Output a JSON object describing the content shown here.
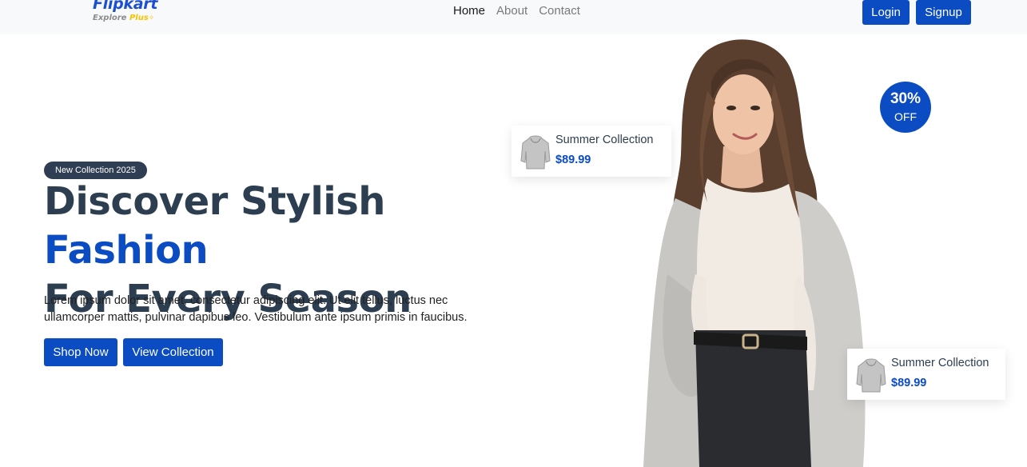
{
  "brand": {
    "name": "Flipkart",
    "sub": "Explore",
    "sub_plus": "Plus"
  },
  "nav": {
    "links": [
      "Home",
      "About",
      "Contact"
    ]
  },
  "auth": {
    "login": "Login",
    "signup": "Signup"
  },
  "hero": {
    "badge": "New Collection 2025",
    "title_part1": "Discover Stylish ",
    "title_accent": "Fashion",
    "title_part2": "For Every Season",
    "description": "Lorem ipsum dolor sit amet, consectetur adipiscing elit. Ut elit tellus, luctus nec ullamcorper mattis, pulvinar dapibus leo. Vestibulum ante ipsum primis in faucibus.",
    "shop_now": "Shop Now",
    "view_collection": "View Collection"
  },
  "cards": [
    {
      "title": "Summer Collection",
      "price": "$89.99",
      "thumb_icon": "hoodie-icon"
    },
    {
      "title": "Summer Collection",
      "price": "$89.99",
      "thumb_icon": "hoodie-icon"
    }
  ],
  "discount": {
    "percent": "30%",
    "label": "OFF"
  },
  "colors": {
    "primary": "#0b4cc2",
    "heading": "#2c3e50",
    "badge_bg": "#2f3e52",
    "navbar_bg": "#f8f9fa"
  }
}
